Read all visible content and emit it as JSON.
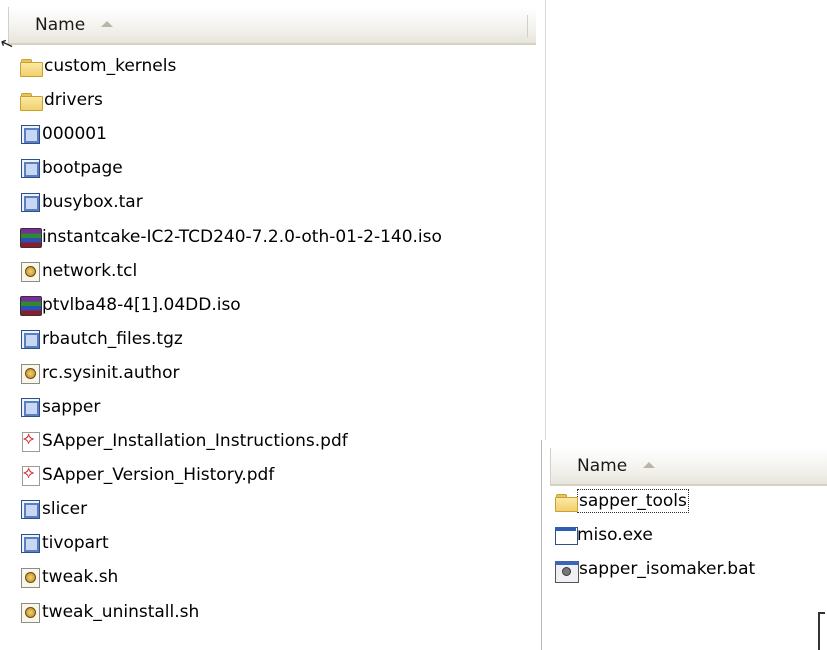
{
  "left_pane": {
    "column_header": "Name",
    "files": [
      {
        "name": "custom_kernels",
        "icon": "folder-icon"
      },
      {
        "name": "drivers",
        "icon": "folder-icon"
      },
      {
        "name": "000001",
        "icon": "application-file-icon"
      },
      {
        "name": "bootpage",
        "icon": "application-file-icon"
      },
      {
        "name": "busybox.tar",
        "icon": "application-file-icon"
      },
      {
        "name": "instantcake-IC2-TCD240-7.2.0-oth-01-2-140.iso",
        "icon": "rar-archive-icon"
      },
      {
        "name": "network.tcl",
        "icon": "script-file-icon"
      },
      {
        "name": "ptvlba48-4[1].04DD.iso",
        "icon": "rar-archive-icon"
      },
      {
        "name": "rbautch_files.tgz",
        "icon": "application-file-icon"
      },
      {
        "name": "rc.sysinit.author",
        "icon": "script-file-icon"
      },
      {
        "name": "sapper",
        "icon": "application-file-icon"
      },
      {
        "name": "SApper_Installation_Instructions.pdf",
        "icon": "pdf-icon"
      },
      {
        "name": "SApper_Version_History.pdf",
        "icon": "pdf-icon"
      },
      {
        "name": "slicer",
        "icon": "application-file-icon"
      },
      {
        "name": "tivopart",
        "icon": "application-file-icon"
      },
      {
        "name": "tweak.sh",
        "icon": "script-file-icon"
      },
      {
        "name": "tweak_uninstall.sh",
        "icon": "script-file-icon"
      }
    ]
  },
  "right_pane": {
    "column_header": "Name",
    "files": [
      {
        "name": "sapper_tools",
        "icon": "folder-icon",
        "focused": true
      },
      {
        "name": "miso.exe",
        "icon": "executable-icon"
      },
      {
        "name": "sapper_isomaker.bat",
        "icon": "batch-file-icon"
      }
    ]
  }
}
